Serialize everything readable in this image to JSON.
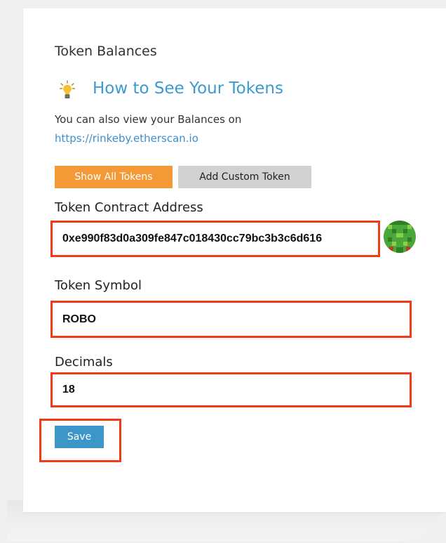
{
  "panel": {
    "title": "Token Balances",
    "tip_link": "How to See Your Tokens",
    "info_text": "You can also view your Balances on",
    "info_link": "https://rinkeby.etherscan.io"
  },
  "tabs": {
    "show_all": "Show All Tokens",
    "add_custom": "Add Custom Token"
  },
  "form": {
    "address_label": "Token Contract Address",
    "address_value": "0xe990f83d0a309fe847c018430cc79bc3b3c6d616",
    "symbol_label": "Token Symbol",
    "symbol_value": "ROBO",
    "decimals_label": "Decimals",
    "decimals_value": "18",
    "save_label": "Save"
  },
  "icons": {
    "tip": "lightbulb-icon",
    "identicon": "identicon-avatar"
  },
  "colors": {
    "accent_orange": "#f39a37",
    "link_blue": "#3b9bd1",
    "save_blue": "#3d96c8",
    "highlight_red": "#f23a14"
  }
}
